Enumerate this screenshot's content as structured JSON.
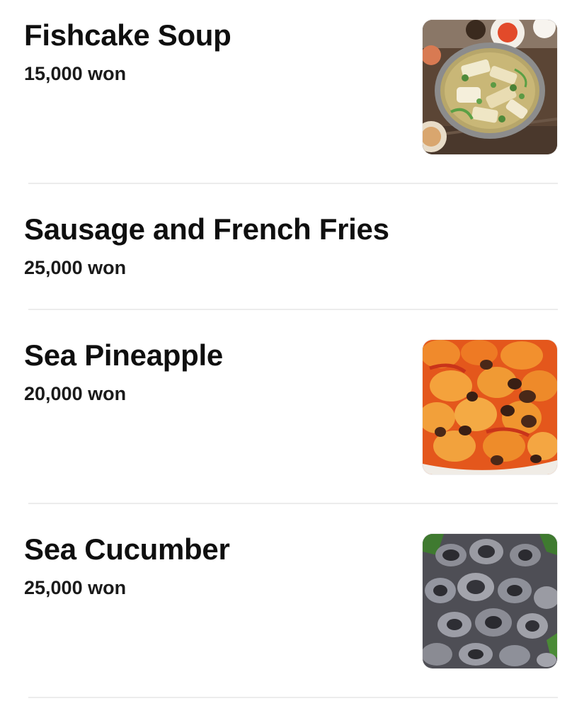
{
  "menu": {
    "items": [
      {
        "name": "Fishcake Soup",
        "price": "15,000 won",
        "image": "fishcake-soup-photo",
        "has_image": true
      },
      {
        "name": "Sausage and French Fries",
        "price": "25,000 won",
        "image": "",
        "has_image": false
      },
      {
        "name": "Sea Pineapple",
        "price": "20,000 won",
        "image": "sea-pineapple-photo",
        "has_image": true
      },
      {
        "name": "Sea Cucumber",
        "price": "25,000 won",
        "image": "sea-cucumber-photo",
        "has_image": true
      }
    ]
  },
  "colors": {
    "text": "#111111",
    "divider": "#ececec",
    "background": "#ffffff"
  }
}
